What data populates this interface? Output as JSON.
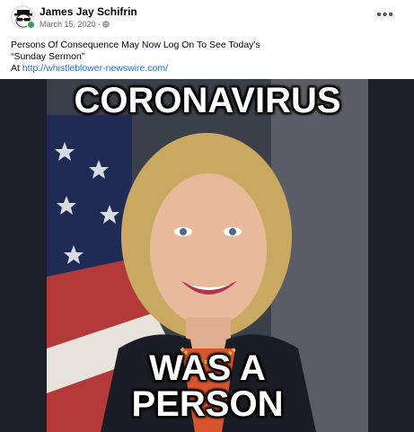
{
  "post": {
    "author": "James Jay Schifrin",
    "date": "March 15, 2020 ·",
    "privacy_icon": "globe-icon",
    "more_label": "•••",
    "text_line1": "Persons Of Consequence May Now Log On To See Today's",
    "text_line2": "“Sunday Sermon”",
    "text_at": "At ",
    "link": "http://whistleblower-newswire.com/"
  },
  "image": {
    "caption_top": "CORONAVIRUS",
    "caption_bottom_1": "WAS A",
    "caption_bottom_2": "PERSON"
  },
  "colors": {
    "link": "#216fdb",
    "online": "#31a24c",
    "media_bg": "#1d1f29"
  }
}
